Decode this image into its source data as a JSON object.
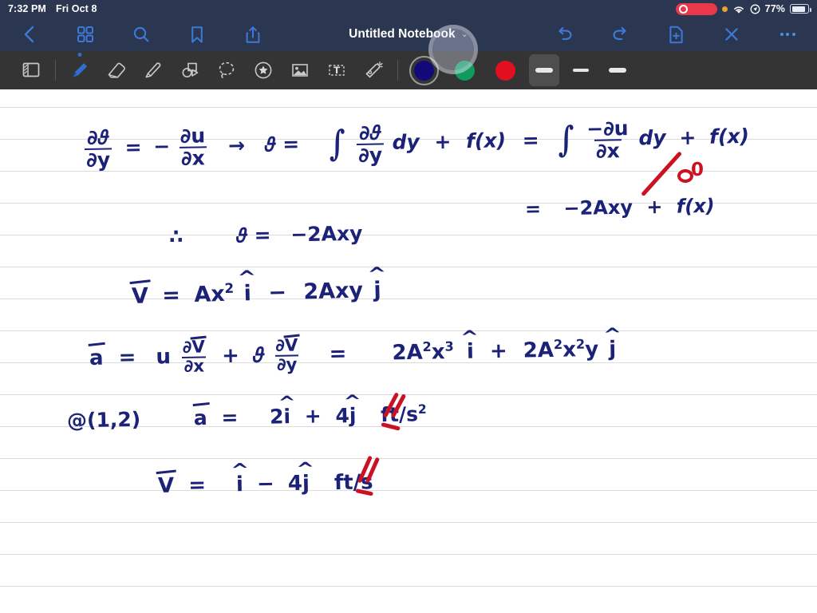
{
  "status_bar": {
    "time": "7:32 PM",
    "date": "Fri Oct 8",
    "battery_percent": "77%",
    "icons": [
      "screen-record-indicator",
      "orange-privacy-dot",
      "wifi-icon",
      "location-icon",
      "battery-icon"
    ]
  },
  "nav_bar": {
    "left_icons": [
      {
        "name": "back-icon",
        "label": "Back"
      },
      {
        "name": "grid-icon",
        "label": "Page Grid"
      },
      {
        "name": "search-icon",
        "label": "Search"
      },
      {
        "name": "bookmark-icon",
        "label": "Bookmark"
      },
      {
        "name": "share-icon",
        "label": "Share"
      }
    ],
    "title": "Untitled Notebook",
    "title_chevron": "⌄",
    "right_icons": [
      {
        "name": "undo-icon",
        "label": "Undo"
      },
      {
        "name": "redo-icon",
        "label": "Redo"
      },
      {
        "name": "new-page-icon",
        "label": "New Page"
      },
      {
        "name": "close-icon",
        "label": "Close"
      },
      {
        "name": "more-icon",
        "label": "More"
      }
    ]
  },
  "toolbar": {
    "tools": [
      {
        "name": "page-style-icon",
        "label": "Page Style",
        "selected": false
      },
      {
        "name": "pen-icon",
        "label": "Pen",
        "selected": true
      },
      {
        "name": "eraser-icon",
        "label": "Eraser",
        "selected": false
      },
      {
        "name": "highlighter-icon",
        "label": "Highlighter",
        "selected": false
      },
      {
        "name": "shapes-icon",
        "label": "Shapes",
        "selected": false
      },
      {
        "name": "lasso-icon",
        "label": "Lasso",
        "selected": false
      },
      {
        "name": "sticker-icon",
        "label": "Sticker",
        "selected": false
      },
      {
        "name": "image-icon",
        "label": "Image",
        "selected": false
      },
      {
        "name": "text-box-icon",
        "label": "Text Box",
        "selected": false
      },
      {
        "name": "laser-pointer-icon",
        "label": "Laser Pointer",
        "selected": false
      }
    ],
    "colors": [
      {
        "name": "color-navy",
        "hex": "#120a7a",
        "selected": true
      },
      {
        "name": "color-green",
        "hex": "#0f9a5e",
        "selected": false
      },
      {
        "name": "color-red",
        "hex": "#e01020",
        "selected": false
      }
    ],
    "thicknesses": [
      {
        "name": "thickness-thick",
        "size": "thick",
        "selected": true
      },
      {
        "name": "thickness-medium",
        "size": "medium",
        "selected": false
      },
      {
        "name": "thickness-thin",
        "size": "thin",
        "selected": false
      }
    ]
  },
  "page": {
    "ruled_line_spacing_px": 40,
    "notes": [
      {
        "id": "l1a",
        "text": "∂v/∂y  =  − ∂u/∂x   →   v ="
      },
      {
        "id": "l1b",
        "text": "∫ ∂v/∂y dy  +  f(x)  =  ∫ −∂u/∂x dy + f(x)"
      },
      {
        "id": "l2",
        "text": "=  −2Axy  +  f(x)"
      },
      {
        "id": "l2r",
        "text": "0",
        "color": "red"
      },
      {
        "id": "l3",
        "text": "∴    v =  −2Axy"
      },
      {
        "id": "l4",
        "text": "V⃗ =  Ax²î  −  2Axyĵ"
      },
      {
        "id": "l5",
        "text": "a⃗ =  u ∂V⃗/∂x  +  v ∂V⃗/∂y  =  2A²x³î  +  2A²x²yĵ"
      },
      {
        "id": "l6",
        "text": "@(1,2)    a⃗ =  2î + 4ĵ   ft/s²"
      },
      {
        "id": "l7",
        "text": "V⃗ =  î − 4ĵ   ft/s"
      }
    ],
    "ink_color": "#1c2277",
    "annotation_color": "#cc1122",
    "math": {
      "partial": "∂",
      "v_sym": "𝜗",
      "u_sym": "u",
      "x_sym": "x",
      "y_sym": "y",
      "dy": "dy",
      "fx": "f(x)",
      "arrow": "→",
      "therefore": "∴",
      "eq": "=",
      "plus": "+",
      "minus": "−",
      "neg2Axy": "-2Axy",
      "A": "A",
      "coord": "@(1,2)",
      "units_accel": "ft/s",
      "units_vel": "ft/s",
      "two": "2",
      "four": "4",
      "zero": "0",
      "i_hat": "i",
      "j_hat": "j",
      "V": "V",
      "a": "a",
      "Ax2": "Ax",
      "exp2": "2",
      "exp3": "3",
      "twoA": "2A",
      "twoAxy": "2Axy",
      "int": "∫"
    }
  }
}
